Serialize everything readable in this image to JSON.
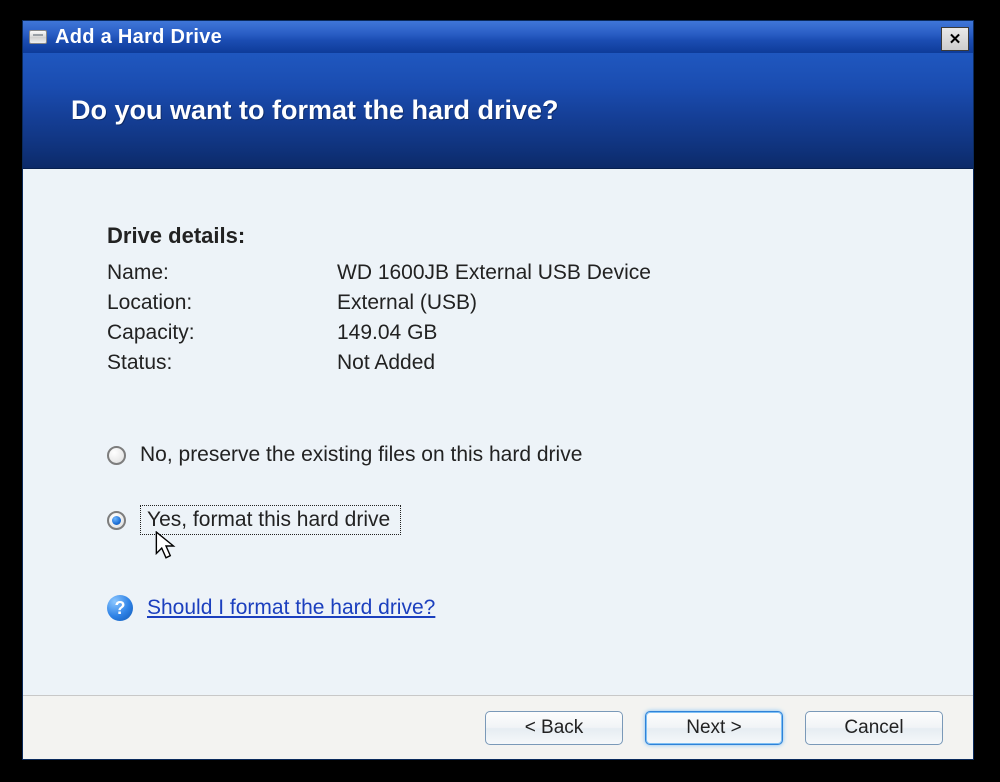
{
  "window": {
    "title": "Add a Hard Drive",
    "close_glyph": "✕"
  },
  "header": {
    "heading": "Do you want to format the hard drive?"
  },
  "details": {
    "section_title": "Drive details:",
    "rows": {
      "name_label": "Name:",
      "name_value": "WD 1600JB External USB Device",
      "location_label": "Location:",
      "location_value": "External (USB)",
      "capacity_label": "Capacity:",
      "capacity_value": "149.04 GB",
      "status_label": "Status:",
      "status_value": "Not Added"
    }
  },
  "options": {
    "preserve_label": "No, preserve the existing files on this hard drive",
    "format_label": "Yes, format this hard drive",
    "selected": "format"
  },
  "help": {
    "icon_glyph": "?",
    "link_text": "Should I format the hard drive?"
  },
  "footer": {
    "back_label": "< Back",
    "next_label": "Next >",
    "cancel_label": "Cancel"
  }
}
